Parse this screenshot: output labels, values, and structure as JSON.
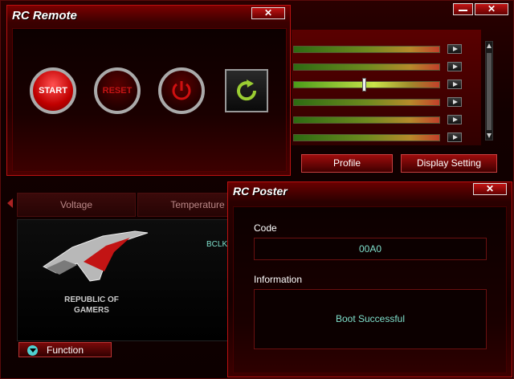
{
  "remote": {
    "title": "RC Remote",
    "close_label": "✕",
    "start_label": "START",
    "reset_label": "RESET"
  },
  "main": {
    "close_label": "✕",
    "profile_label": "Profile",
    "display_setting_label": "Display Setting",
    "tabs": [
      {
        "label": "Voltage"
      },
      {
        "label": "Temperature"
      }
    ],
    "bclk_label": "BCLK",
    "function_label": "Function",
    "logo_line1": "REPUBLIC OF",
    "logo_line2": "GAMERS"
  },
  "poster": {
    "title": "RC Poster",
    "close_label": "✕",
    "code_label": "Code",
    "code_value": "00A0",
    "info_label": "Information",
    "info_value": "Boot Successful"
  },
  "colors": {
    "accent": "#c21414",
    "field_text": "#7fe0cc"
  }
}
